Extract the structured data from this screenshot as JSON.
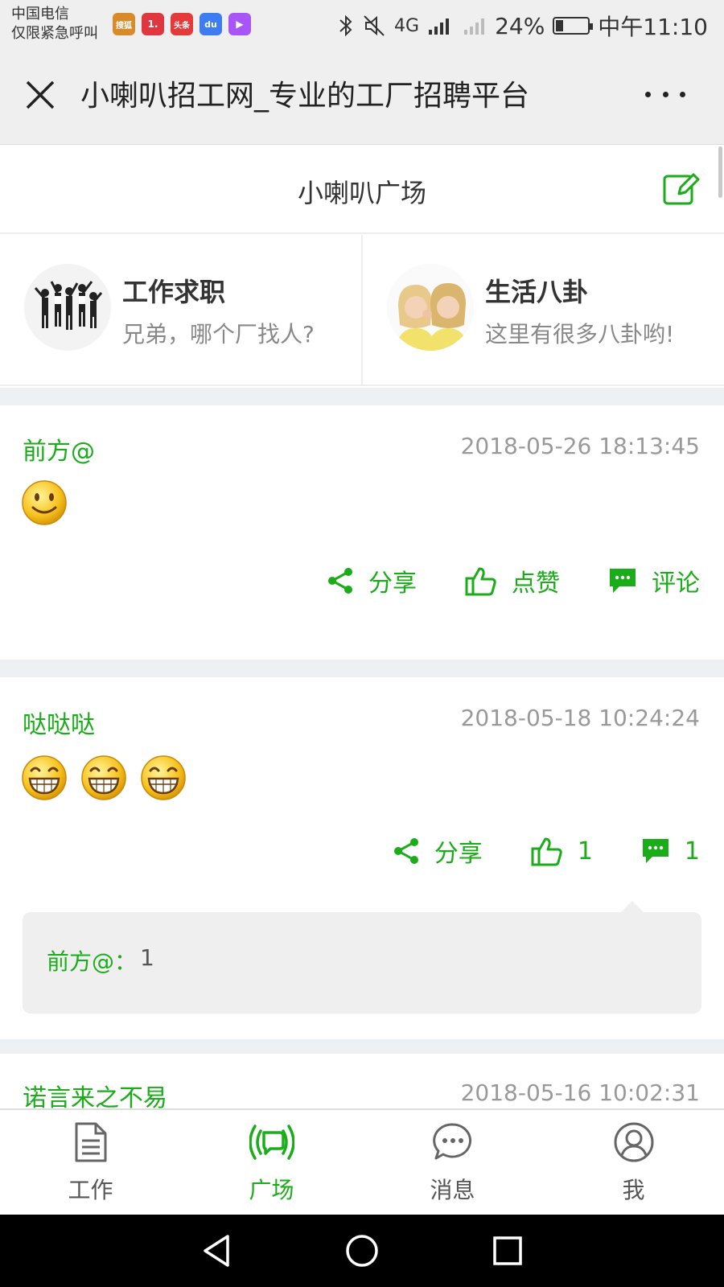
{
  "status_bar": {
    "carrier_line1": "中国电信",
    "carrier_line2": "仅限紧急呼叫",
    "app_icons": [
      "搜狐",
      "1.",
      "头条",
      "du",
      "▶"
    ],
    "signal": "4G",
    "battery_percent": "24%",
    "battery_level": 0.24,
    "time": "中午11:10"
  },
  "title_bar": {
    "title": "小喇叭招工网_专业的工厂招聘平台"
  },
  "plaza": {
    "title": "小喇叭广场"
  },
  "categories": [
    {
      "title": "工作求职",
      "subtitle": "兄弟，哪个厂找人?"
    },
    {
      "title": "生活八卦",
      "subtitle": "这里有很多八卦哟!"
    }
  ],
  "posts": [
    {
      "author": "前方@",
      "time": "2018-05-26 18:13:45",
      "emojis": [
        "smile-emoji"
      ],
      "share_label": "分享",
      "like_label": "点赞",
      "comment_label": "评论"
    },
    {
      "author": "哒哒哒",
      "time": "2018-05-18 10:24:24",
      "emojis": [
        "grin-emoji",
        "grin-emoji",
        "grin-emoji"
      ],
      "share_label": "分享",
      "like_label": "1",
      "comment_label": "1",
      "comments": [
        {
          "author": "前方@：",
          "text": "1"
        }
      ]
    },
    {
      "author": "诺言来之不易",
      "time": "2018-05-16 10:02:31"
    }
  ],
  "tabs": [
    {
      "label": "工作",
      "icon": "document-icon",
      "active": false
    },
    {
      "label": "广场",
      "icon": "broadcast-icon",
      "active": true
    },
    {
      "label": "消息",
      "icon": "chat-bubble-icon",
      "active": false
    },
    {
      "label": "我",
      "icon": "user-icon",
      "active": false
    }
  ],
  "colors": {
    "accent": "#1aad19",
    "bar_bg": "#efefef",
    "divider": "#edf1f4"
  }
}
